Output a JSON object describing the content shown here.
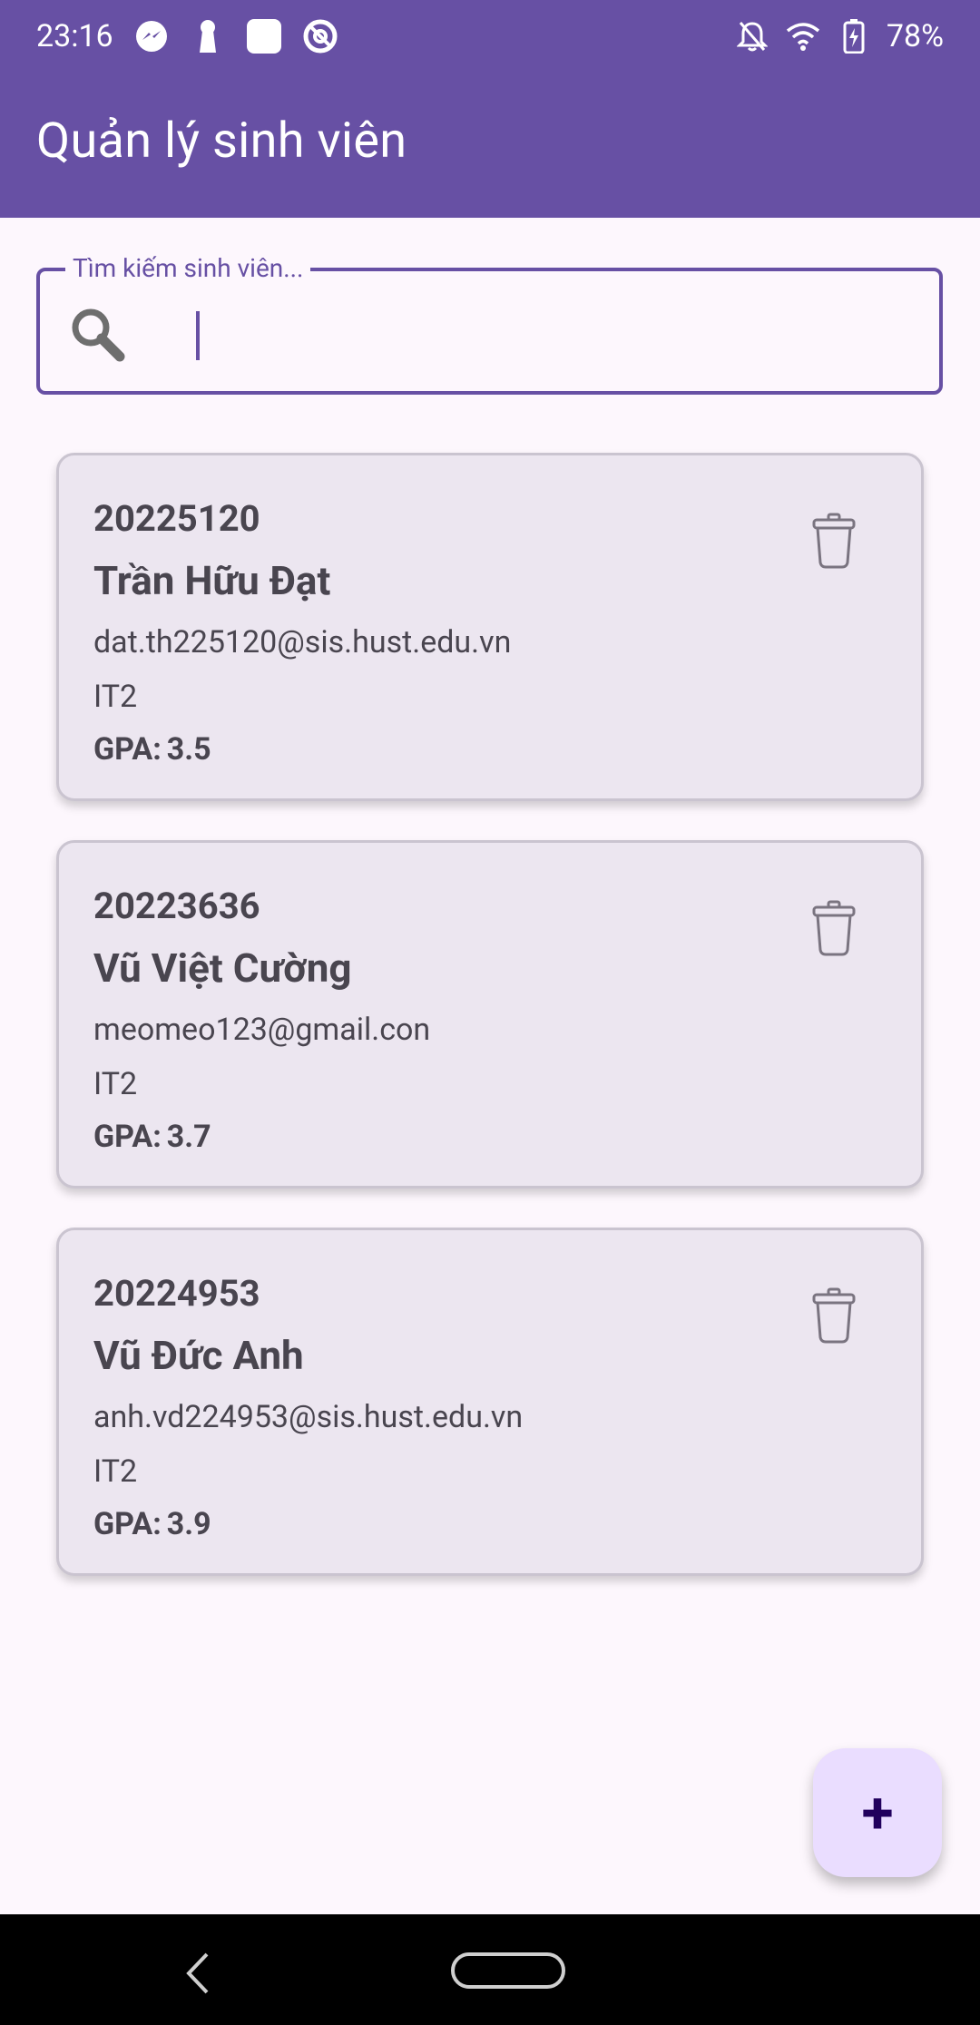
{
  "status_bar": {
    "time": "23:16",
    "battery": "78%",
    "left_icons": [
      "messenger-icon",
      "keyhole-icon",
      "square-icon",
      "at-sign-icon"
    ],
    "right_icons": [
      "bell-off-icon",
      "wifi-icon",
      "battery-charging-icon"
    ]
  },
  "app_bar": {
    "title": "Quản lý sinh viên"
  },
  "search": {
    "label": "Tìm kiếm sinh viên...",
    "value": ""
  },
  "students": [
    {
      "id": "20225120",
      "name": "Trần Hữu Đạt",
      "email": "dat.th225120@sis.hust.edu.vn",
      "class": "IT2",
      "gpa_label": "GPA:",
      "gpa": "3.5"
    },
    {
      "id": "20223636",
      "name": "Vũ Việt Cường",
      "email": "meomeo123@gmail.con",
      "class": "IT2",
      "gpa_label": "GPA:",
      "gpa": "3.7"
    },
    {
      "id": "20224953",
      "name": "Vũ Đức Anh",
      "email": "anh.vd224953@sis.hust.edu.vn",
      "class": "IT2",
      "gpa_label": "GPA:",
      "gpa": "3.9"
    }
  ],
  "fab": {
    "label": "+"
  },
  "colors": {
    "primary": "#6750a4",
    "card_bg": "#ece6f0",
    "fab_bg": "#eaddff",
    "background": "#fdf7fd"
  }
}
